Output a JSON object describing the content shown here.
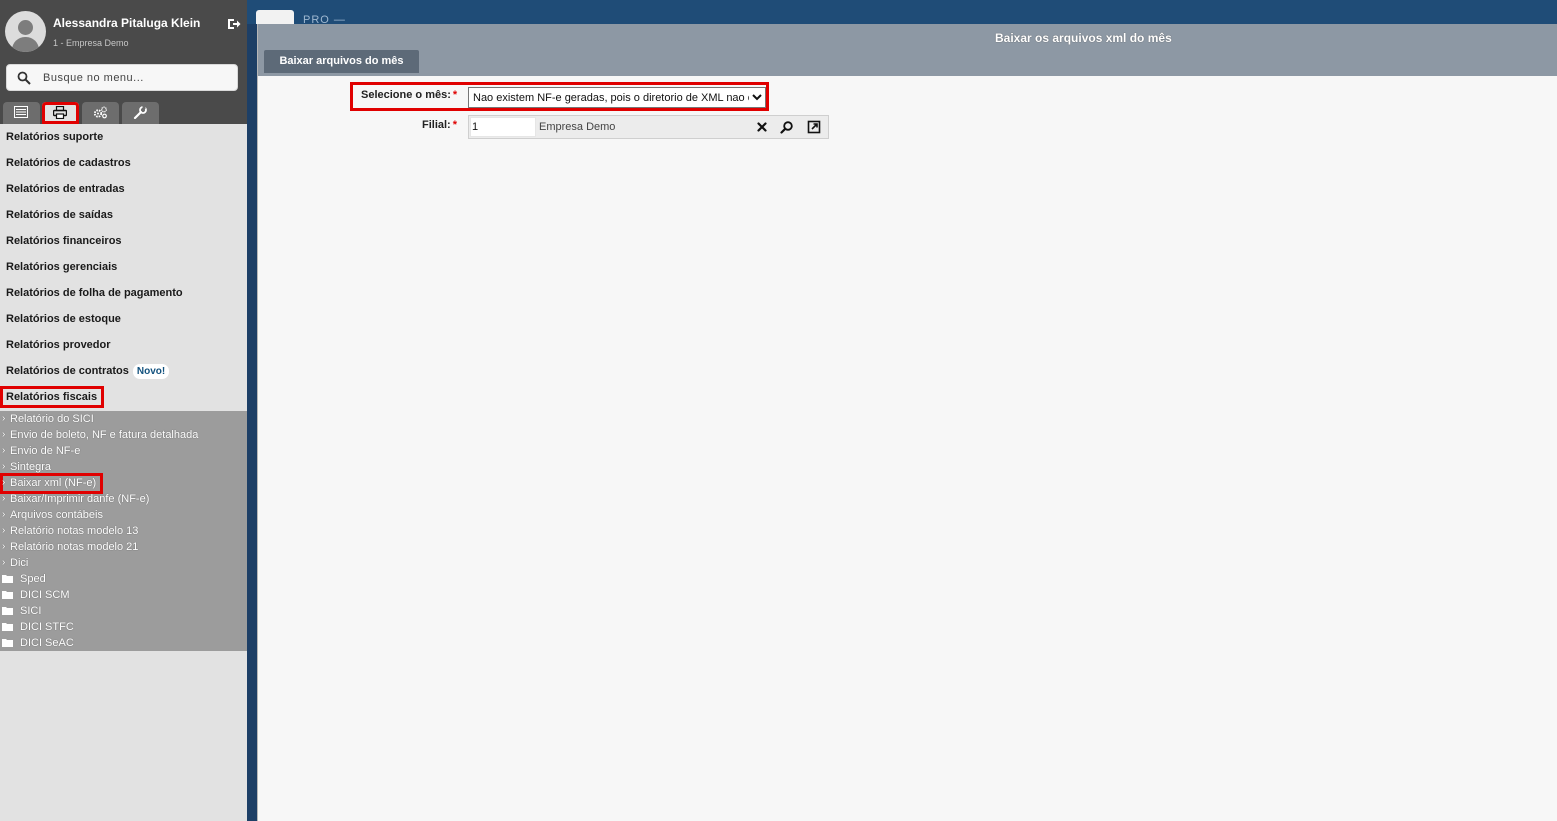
{
  "user": {
    "name": "Alessandra Pitaluga Klein",
    "company": "1 - Empresa Demo"
  },
  "search": {
    "placeholder": "Busque no menu..."
  },
  "menu_tabs": [
    {
      "icon": "list-icon",
      "active": false
    },
    {
      "icon": "printer-icon",
      "active": true
    },
    {
      "icon": "gears-icon",
      "active": false
    },
    {
      "icon": "wrench-icon",
      "active": false
    }
  ],
  "reports": {
    "items": [
      {
        "label": "Relatórios suporte"
      },
      {
        "label": "Relatórios de cadastros"
      },
      {
        "label": "Relatórios de entradas"
      },
      {
        "label": "Relatórios de saídas"
      },
      {
        "label": "Relatórios financeiros"
      },
      {
        "label": "Relatórios gerenciais"
      },
      {
        "label": "Relatórios de folha de pagamento"
      },
      {
        "label": "Relatórios de estoque"
      },
      {
        "label": "Relatórios provedor"
      },
      {
        "label": "Relatórios de contratos",
        "badge": "Novo!"
      },
      {
        "label": "Relatórios fiscais"
      }
    ]
  },
  "fiscal_submenu": {
    "items": [
      {
        "label": "Relatório do SICI"
      },
      {
        "label": "Envio de boleto, NF e fatura detalhada"
      },
      {
        "label": "Envio de NF-e"
      },
      {
        "label": "Sintegra"
      },
      {
        "label": "Baixar xml (NF-e)"
      },
      {
        "label": "Baixar/Imprimir danfe (NF-e)"
      },
      {
        "label": "Arquivos contábeis"
      },
      {
        "label": "Relatório notas modelo 13"
      },
      {
        "label": "Relatório notas modelo 21"
      },
      {
        "label": "Dici"
      }
    ],
    "folders": [
      {
        "label": "Sped"
      },
      {
        "label": "DICI SCM"
      },
      {
        "label": "SICI"
      },
      {
        "label": "DICI STFC"
      },
      {
        "label": "DICI SeAC"
      }
    ]
  },
  "topbar": {
    "label": "PRO —"
  },
  "window": {
    "title": "Baixar os arquivos xml do mês",
    "tab_label": "Baixar arquivos do mês"
  },
  "form": {
    "month_label": "Selecione o mês:",
    "month_selected": "Nao existem NF-e geradas, pois o diretorio de XML nao existe",
    "required_mark": "*",
    "filial_label": "Filial:",
    "filial_code": "1",
    "filial_name": "Empresa Demo"
  },
  "colors": {
    "highlight": "#e00000",
    "sidebar_dark": "#4a4a4a",
    "submenu_bg": "#9c9c9c",
    "window_header": "#8d98a4",
    "tab_bg": "#5d6a78"
  }
}
